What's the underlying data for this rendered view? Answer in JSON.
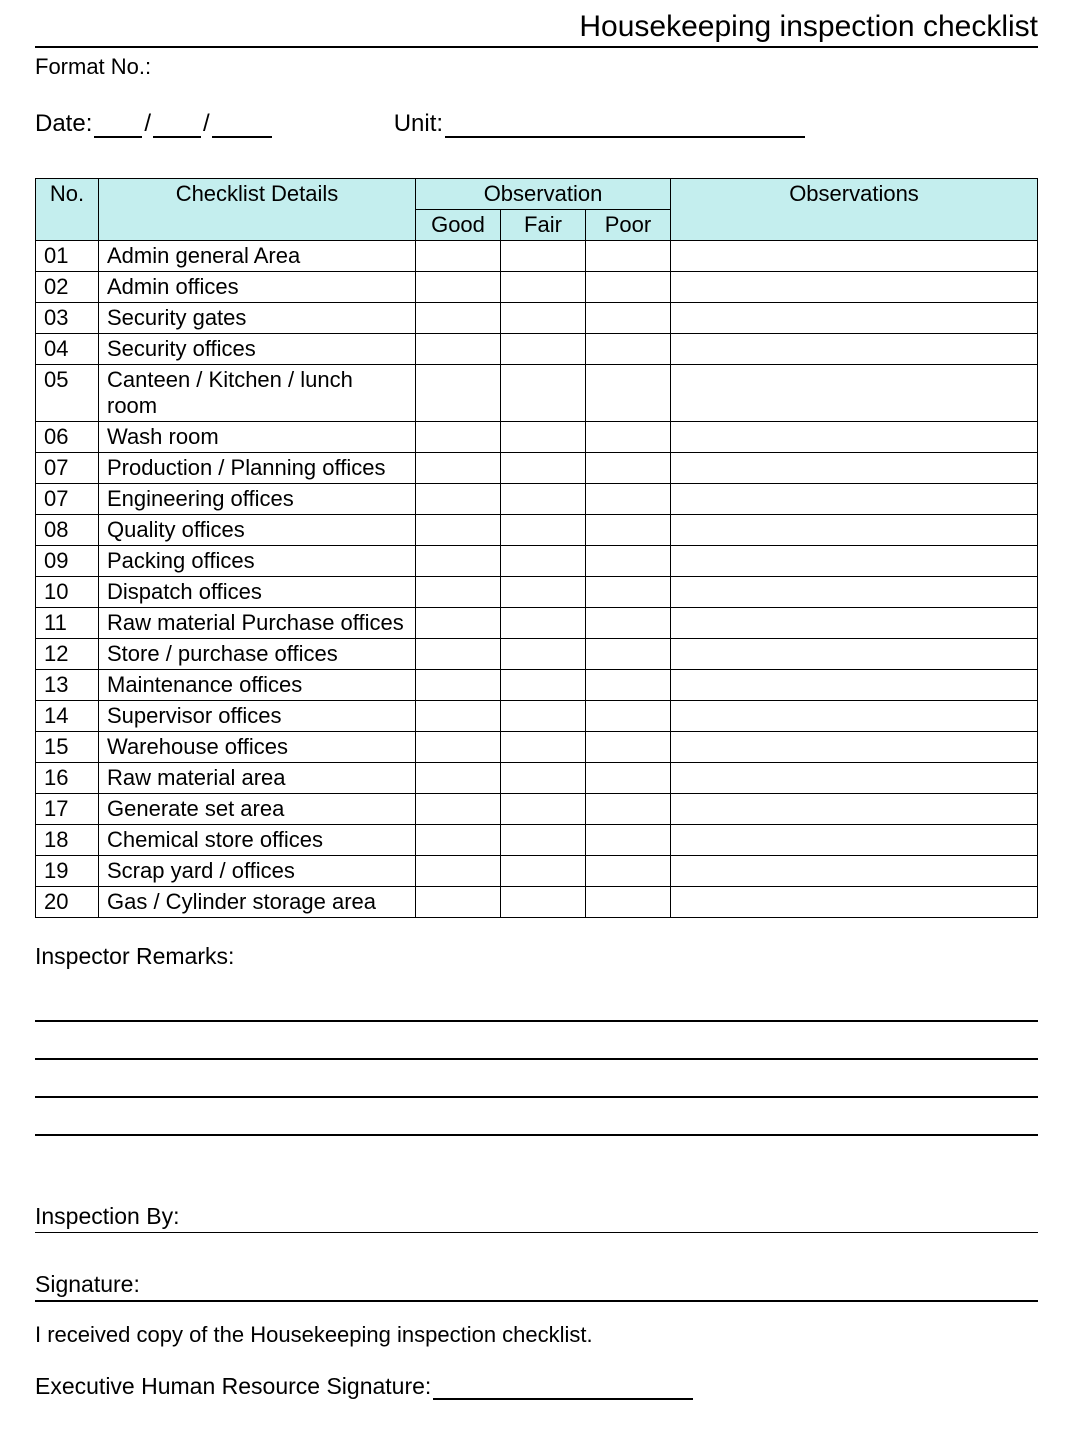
{
  "title": "Housekeeping inspection checklist",
  "format_label": "Format No.:",
  "date_label": "Date:",
  "date_sep": "/",
  "unit_label": "Unit:",
  "table": {
    "headers": {
      "no": "No.",
      "details": "Checklist Details",
      "observation": "Observation",
      "good": "Good",
      "fair": "Fair",
      "poor": "Poor",
      "observations": "Observations"
    },
    "rows": [
      {
        "no": "01",
        "detail": "Admin general Area"
      },
      {
        "no": "02",
        "detail": "Admin offices"
      },
      {
        "no": "03",
        "detail": "Security gates"
      },
      {
        "no": "04",
        "detail": "Security offices"
      },
      {
        "no": "05",
        "detail": "Canteen / Kitchen / lunch room"
      },
      {
        "no": "06",
        "detail": "Wash room"
      },
      {
        "no": "07",
        "detail": "Production / Planning offices"
      },
      {
        "no": "07",
        "detail": "Engineering offices"
      },
      {
        "no": "08",
        "detail": "Quality offices"
      },
      {
        "no": "09",
        "detail": "Packing offices"
      },
      {
        "no": "10",
        "detail": "Dispatch offices"
      },
      {
        "no": "11",
        "detail": "Raw material Purchase offices"
      },
      {
        "no": "12",
        "detail": "Store / purchase offices"
      },
      {
        "no": "13",
        "detail": "Maintenance offices"
      },
      {
        "no": "14",
        "detail": "Supervisor offices"
      },
      {
        "no": "15",
        "detail": "Warehouse offices"
      },
      {
        "no": "16",
        "detail": "Raw material area"
      },
      {
        "no": "17",
        "detail": "Generate set area"
      },
      {
        "no": "18",
        "detail": "Chemical store offices"
      },
      {
        "no": "19",
        "detail": "Scrap yard / offices"
      },
      {
        "no": "20",
        "detail": "Gas / Cylinder storage area"
      }
    ]
  },
  "remarks_label": "Inspector Remarks:",
  "inspection_by_label": "Inspection By:",
  "signature_label": "Signature:",
  "ack_text": "I received copy of the Housekeeping inspection checklist.",
  "hr_sig_label": "Executive Human Resource Signature:"
}
